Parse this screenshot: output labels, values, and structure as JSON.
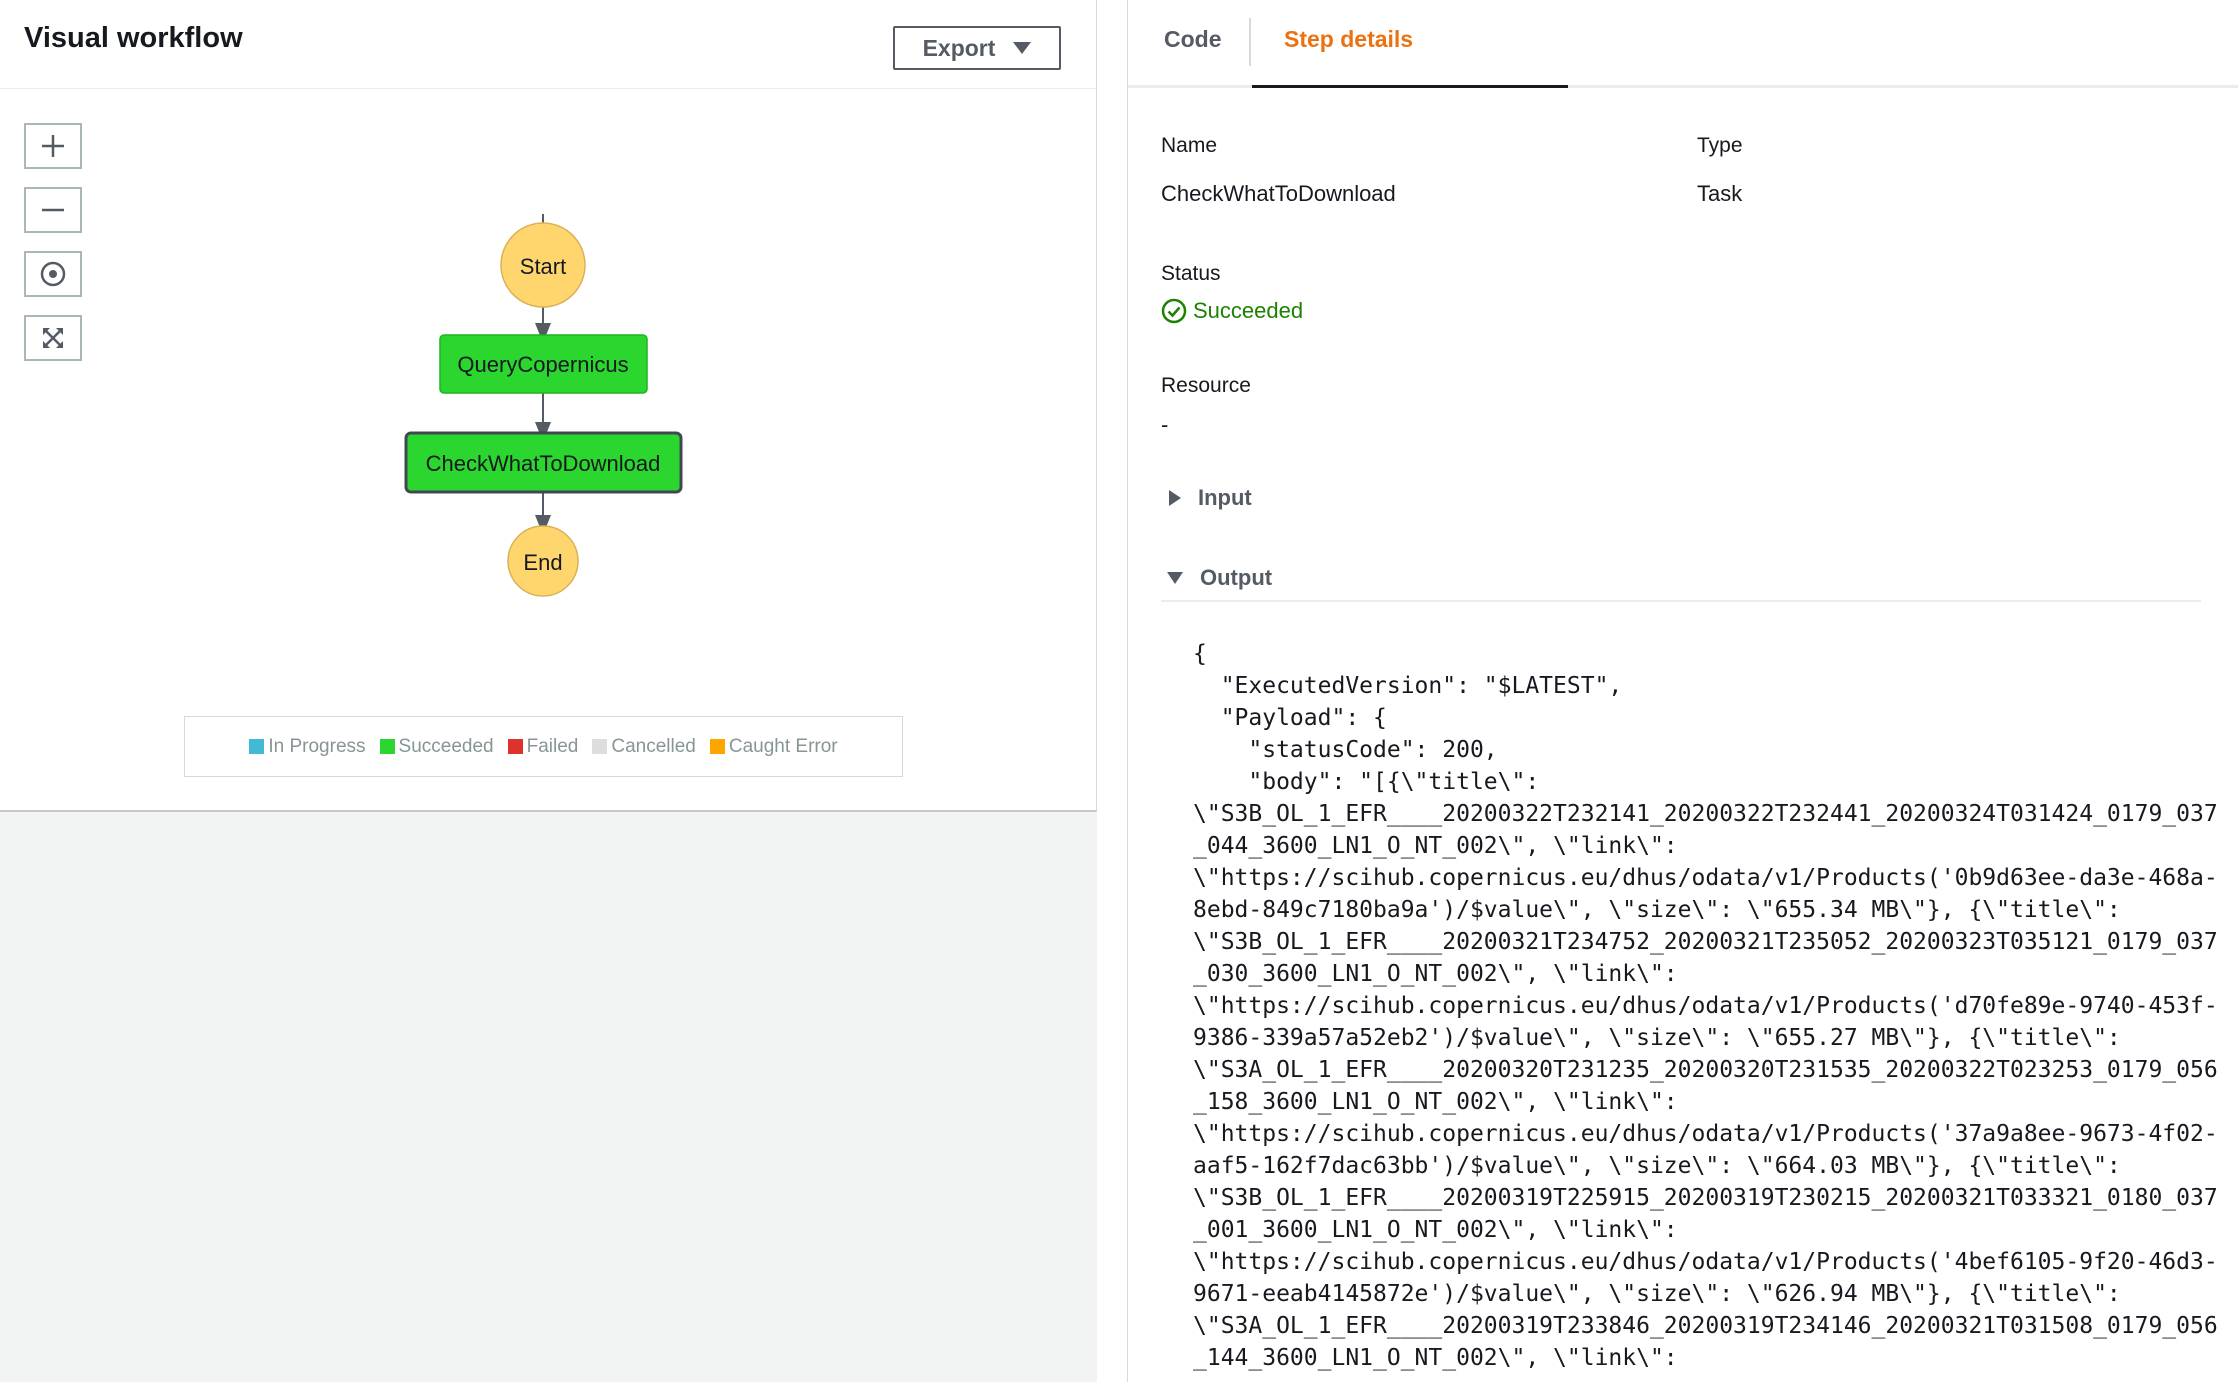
{
  "workflow": {
    "title": "Visual workflow",
    "export_label": "Export",
    "zoom_controls": [
      "zoom-in-icon",
      "zoom-out-icon",
      "center-icon",
      "fit-to-screen-icon"
    ],
    "nodes": {
      "start": "Start",
      "query": "QueryCopernicus",
      "check": "CheckWhatToDownload",
      "end": "End"
    },
    "legend": [
      {
        "label": "In Progress",
        "color": "#44b9d6"
      },
      {
        "label": "Succeeded",
        "color": "#2bd62e"
      },
      {
        "label": "Failed",
        "color": "#de322f"
      },
      {
        "label": "Cancelled",
        "color": "#dddddd"
      },
      {
        "label": "Caught Error",
        "color": "#ffa500"
      }
    ]
  },
  "tabs": {
    "code": "Code",
    "step_details": "Step details",
    "active": "Step details"
  },
  "details": {
    "name_label": "Name",
    "name_value": "CheckWhatToDownload",
    "type_label": "Type",
    "type_value": "Task",
    "status_label": "Status",
    "status_value": "Succeeded",
    "resource_label": "Resource",
    "resource_value": "-",
    "input_label": "Input",
    "output_label": "Output",
    "output_text": "{\n  \"ExecutedVersion\": \"$LATEST\",\n  \"Payload\": {\n    \"statusCode\": 200,\n    \"body\": \"[{\\\"title\\\":\n\\\"S3B_OL_1_EFR____20200322T232141_20200322T232441_20200324T031424_0179_037\n_044_3600_LN1_O_NT_002\\\", \\\"link\\\":\n\\\"https://scihub.copernicus.eu/dhus/odata/v1/Products('0b9d63ee-da3e-468a-\n8ebd-849c7180ba9a')/$value\\\", \\\"size\\\": \\\"655.34 MB\\\"}, {\\\"title\\\":\n\\\"S3B_OL_1_EFR____20200321T234752_20200321T235052_20200323T035121_0179_037\n_030_3600_LN1_O_NT_002\\\", \\\"link\\\":\n\\\"https://scihub.copernicus.eu/dhus/odata/v1/Products('d70fe89e-9740-453f-\n9386-339a57a52eb2')/$value\\\", \\\"size\\\": \\\"655.27 MB\\\"}, {\\\"title\\\":\n\\\"S3A_OL_1_EFR____20200320T231235_20200320T231535_20200322T023253_0179_056\n_158_3600_LN1_O_NT_002\\\", \\\"link\\\":\n\\\"https://scihub.copernicus.eu/dhus/odata/v1/Products('37a9a8ee-9673-4f02-\naaf5-162f7dac63bb')/$value\\\", \\\"size\\\": \\\"664.03 MB\\\"}, {\\\"title\\\":\n\\\"S3B_OL_1_EFR____20200319T225915_20200319T230215_20200321T033321_0180_037\n_001_3600_LN1_O_NT_002\\\", \\\"link\\\":\n\\\"https://scihub.copernicus.eu/dhus/odata/v1/Products('4bef6105-9f20-46d3-\n9671-eeab4145872e')/$value\\\", \\\"size\\\": \\\"626.94 MB\\\"}, {\\\"title\\\":\n\\\"S3A_OL_1_EFR____20200319T233846_20200319T234146_20200321T031508_0179_056\n_144_3600_LN1_O_NT_002\\\", \\\"link\\\":"
  },
  "colors": {
    "succeeded_node": "#2bd62e",
    "terminal_node": "#ffd66e",
    "accent_tab": "#ec7211",
    "status_success": "#1d8102"
  }
}
